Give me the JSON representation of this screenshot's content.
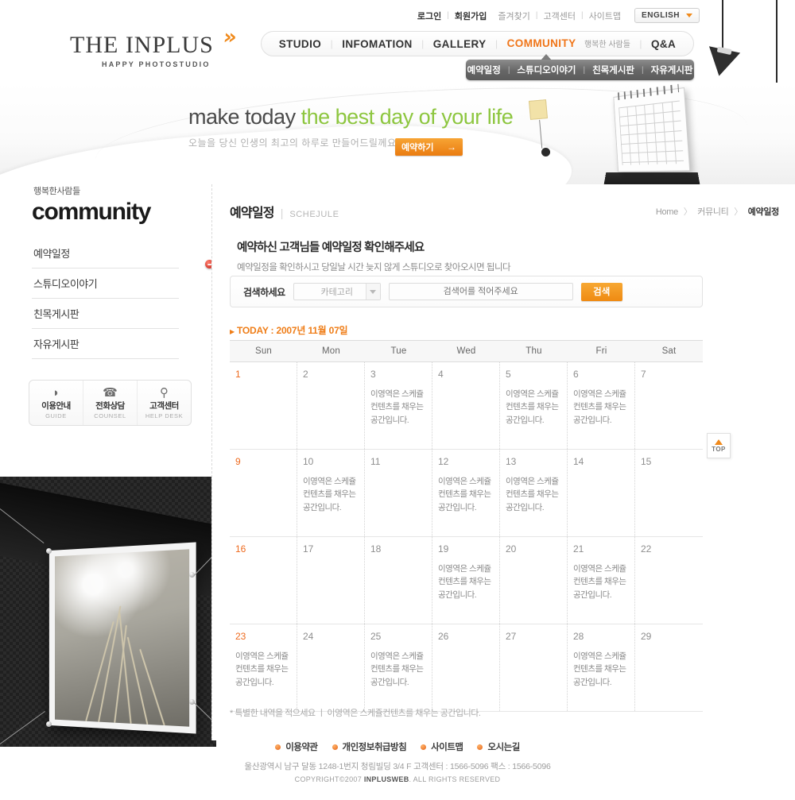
{
  "topbar": {
    "links": [
      {
        "label": "로그인",
        "style": "bold"
      },
      {
        "label": "회원가입",
        "style": "bold"
      },
      {
        "label": "즐겨찾기",
        "style": "plain"
      },
      {
        "label": "고객센터",
        "style": "plain"
      },
      {
        "label": "사이트맵",
        "style": "plain"
      }
    ],
    "language": "ENGLISH"
  },
  "logo": {
    "main": "THE INPLUS",
    "sub": "HAPPY PHOTOSTUDIO",
    "mark": "»"
  },
  "nav": {
    "items": [
      {
        "label": "STUDIO",
        "active": false
      },
      {
        "label": "INFOMATION",
        "active": false
      },
      {
        "label": "GALLERY",
        "active": false
      },
      {
        "label": "COMMUNITY",
        "active": true,
        "tag": "행복한 사람들"
      },
      {
        "label": "Q&A",
        "active": false
      }
    ],
    "submenu": [
      "예약일정",
      "스튜디오이야기",
      "친목게시판",
      "자유게시판"
    ]
  },
  "hero": {
    "line1_a": "make today ",
    "line1_b": "the best day of your life",
    "line2": "오늘을 당신 인생의 최고의 하루로 만들어드릴께요",
    "button": "예약하기",
    "button_arrow": "→",
    "accent_color": "#8dc63f"
  },
  "sidebar": {
    "tag": "행복한사람들",
    "title": "community",
    "items": [
      {
        "label": "예약일정"
      },
      {
        "label": "스튜디오이야기"
      },
      {
        "label": "친목게시판"
      },
      {
        "label": "자유게시판"
      }
    ],
    "quicklinks": [
      {
        "ko": "이용안내",
        "en": "GUIDE",
        "icon": "book-icon",
        "glyph": "◔"
      },
      {
        "ko": "전화상담",
        "en": "COUNSEL",
        "icon": "telephone-icon",
        "glyph": "☎"
      },
      {
        "ko": "고객센터",
        "en": "HELP DESK",
        "icon": "magnifier-icon",
        "glyph": "🔍"
      }
    ]
  },
  "page": {
    "title_ko": "예약일정",
    "title_en": "SCHEJULE",
    "breadcrumb": {
      "home": "Home",
      "mid": "커뮤니티",
      "current": "예약일정",
      "sep": "〉"
    },
    "intro_title": "예약하신 고객님들 예약일정 확인해주세요",
    "intro_sub": "예약일정을 확인하시고 당일날 시간 늦지 않게 스튜디오로 찾아오시면 됩니다"
  },
  "search": {
    "label": "검색하세요",
    "category": "카테고리",
    "placeholder": "검색어를 적어주세요",
    "value": "",
    "button": "검색"
  },
  "today_label": "TODAY : 2007년 11월 07일",
  "calendar": {
    "weekdays": [
      "Sun",
      "Mon",
      "Tue",
      "Wed",
      "Thu",
      "Fri",
      "Sat"
    ],
    "event_text": "이영역은 스케쥴 컨텐츠를 채우는 공간입니다.",
    "rows": [
      [
        {
          "day": "1",
          "sunday": true,
          "event": ""
        },
        {
          "day": "2",
          "sunday": false,
          "event": ""
        },
        {
          "day": "3",
          "sunday": false,
          "event": "이영역은 스케쥴 컨텐츠를 채우는 공간입니다."
        },
        {
          "day": "4",
          "sunday": false,
          "event": ""
        },
        {
          "day": "5",
          "sunday": false,
          "event": "이영역은 스케쥴 컨텐츠를 채우는 공간입니다."
        },
        {
          "day": "6",
          "sunday": false,
          "event": "이영역은 스케쥴 컨텐츠를 채우는 공간입니다."
        },
        {
          "day": "7",
          "sunday": false,
          "event": ""
        }
      ],
      [
        {
          "day": "9",
          "sunday": true,
          "event": ""
        },
        {
          "day": "10",
          "sunday": false,
          "event": "이영역은 스케쥴 컨텐츠를 채우는 공간입니다."
        },
        {
          "day": "11",
          "sunday": false,
          "event": ""
        },
        {
          "day": "12",
          "sunday": false,
          "event": "이영역은 스케쥴 컨텐츠를 채우는 공간입니다."
        },
        {
          "day": "13",
          "sunday": false,
          "event": "이영역은 스케쥴 컨텐츠를 채우는 공간입니다."
        },
        {
          "day": "14",
          "sunday": false,
          "event": ""
        },
        {
          "day": "15",
          "sunday": false,
          "event": ""
        }
      ],
      [
        {
          "day": "16",
          "sunday": true,
          "event": ""
        },
        {
          "day": "17",
          "sunday": false,
          "event": ""
        },
        {
          "day": "18",
          "sunday": false,
          "event": ""
        },
        {
          "day": "19",
          "sunday": false,
          "event": "이영역은 스케쥴 컨텐츠를 채우는 공간입니다."
        },
        {
          "day": "20",
          "sunday": false,
          "event": ""
        },
        {
          "day": "21",
          "sunday": false,
          "event": "이영역은 스케쥴 컨텐츠를 채우는 공간입니다."
        },
        {
          "day": "22",
          "sunday": false,
          "event": ""
        }
      ],
      [
        {
          "day": "23",
          "sunday": true,
          "event": "이영역은 스케쥴 컨텐츠를 채우는 공간입니다."
        },
        {
          "day": "24",
          "sunday": false,
          "event": ""
        },
        {
          "day": "25",
          "sunday": false,
          "event": "이영역은 스케쥴 컨텐츠를 채우는 공간입니다."
        },
        {
          "day": "26",
          "sunday": false,
          "event": ""
        },
        {
          "day": "27",
          "sunday": false,
          "event": ""
        },
        {
          "day": "28",
          "sunday": false,
          "event": "이영역은 스케쥴 컨텐츠를 채우는 공간입니다."
        },
        {
          "day": "29",
          "sunday": false,
          "event": ""
        }
      ]
    ],
    "note": "* 특별한 내역을 적으세요 ㅣ 이영역은 스케쥴컨텐츠를 채우는 공간입니다."
  },
  "top_button": {
    "label": "TOP"
  },
  "footer": {
    "links": [
      "이용약관",
      "개인정보취급방침",
      "사이트맵",
      "오시는길"
    ],
    "address": "울산광역시 남구 달동 1248-1번지 청림빌딩 3/4 F 고객센터 : 1566-5096  팩스 : 1566-5096",
    "copyright_pre": "COPYRIGHT©2007 ",
    "copyright_brand": "INPLUSWEB",
    "copyright_post": ". ALL RIGHTS RESERVED"
  },
  "colors": {
    "accent_orange": "#ef7d17",
    "nav_active": "#f0761a",
    "hero_green": "#8dc63f"
  }
}
